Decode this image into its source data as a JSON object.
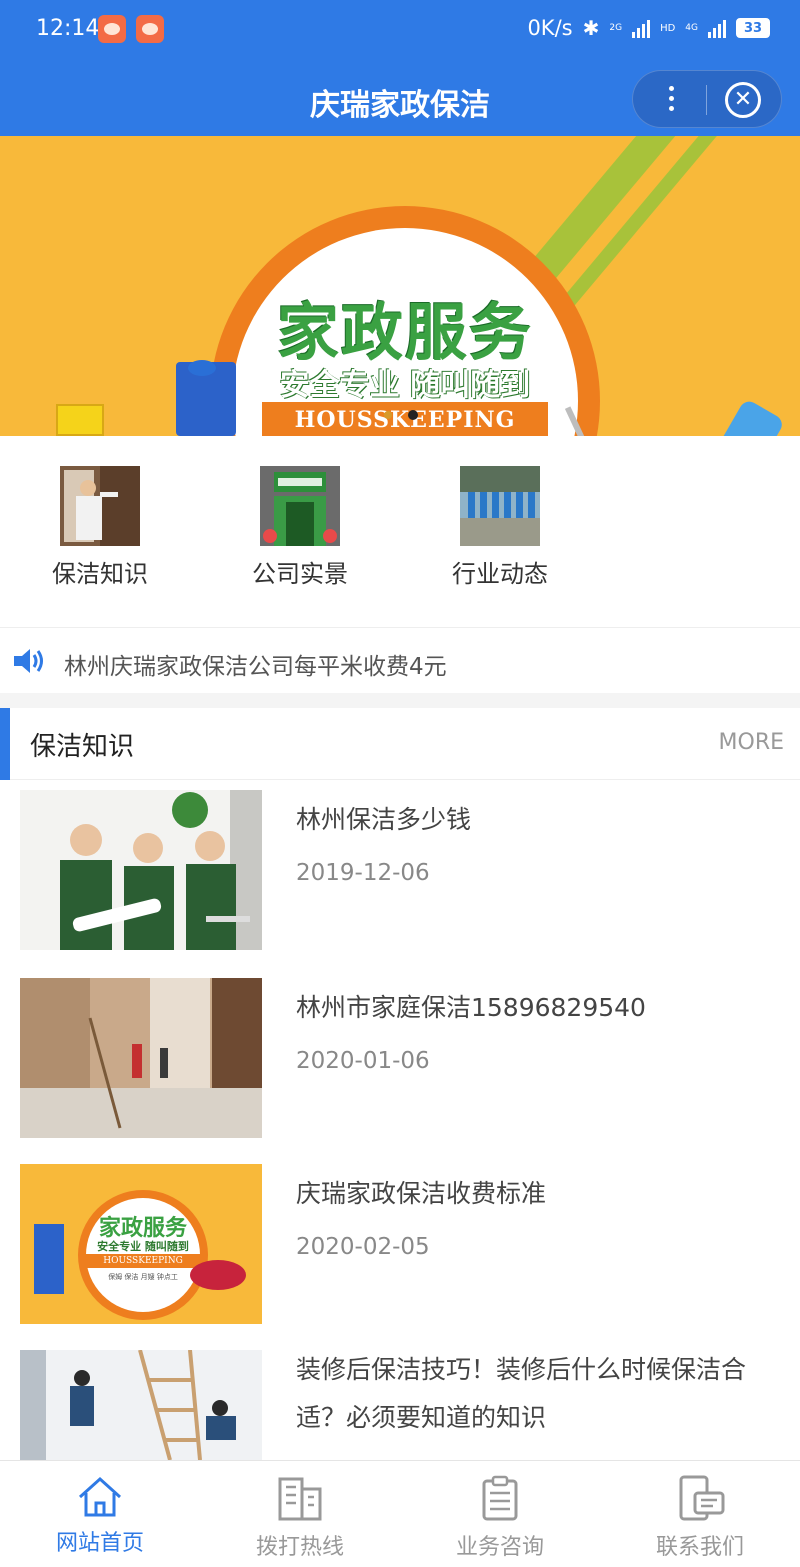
{
  "status_bar": {
    "time": "12:14",
    "net_speed": "0K/s",
    "battery": "33",
    "network_labels": [
      "2G",
      "HD",
      "4G"
    ]
  },
  "header": {
    "title": "庆瑞家政保洁",
    "more_icon": "more-vertical-icon",
    "close_icon": "close-circle-icon"
  },
  "banner": {
    "headline": "家政服务",
    "slogan": "安全专业 随叫随到",
    "ribbon": "HOUSSKEEPING",
    "active_dot": 1,
    "dot_count": 2
  },
  "quick_links": [
    {
      "label": "保洁知识",
      "icon": "cleaning-photo"
    },
    {
      "label": "公司实景",
      "icon": "office-photo"
    },
    {
      "label": "行业动态",
      "icon": "team-photo"
    }
  ],
  "notice": {
    "icon": "speaker-icon",
    "text": "林州庆瑞家政保洁公司每平米收费4元"
  },
  "section": {
    "title": "保洁知识",
    "more": "MORE"
  },
  "articles": [
    {
      "title": "林州保洁多少钱",
      "date": "2019-12-06"
    },
    {
      "title": "林州市家庭保洁15896829540",
      "date": "2020-01-06"
    },
    {
      "title": "庆瑞家政保洁收费标准",
      "date": "2020-02-05"
    },
    {
      "title": "装修后保洁技巧！装修后什么时候保洁合适？必须要知道的知识",
      "date": ""
    }
  ],
  "article_thumb_3": {
    "headline": "家政服务",
    "slogan": "安全专业 随叫随到",
    "ribbon": "HOUSSKEEPING",
    "tags": "保姆  保洁  月嫂  钟点工"
  },
  "tabbar": [
    {
      "label": "网站首页",
      "icon": "home-icon",
      "active": true
    },
    {
      "label": "拨打热线",
      "icon": "building-icon",
      "active": false
    },
    {
      "label": "业务咨询",
      "icon": "clipboard-icon",
      "active": false
    },
    {
      "label": "联系我们",
      "icon": "phone-contact-icon",
      "active": false
    }
  ],
  "colors": {
    "brand_blue": "#2f7ae5",
    "banner_orange": "#f8b93a",
    "banner_green": "#3aa142"
  }
}
